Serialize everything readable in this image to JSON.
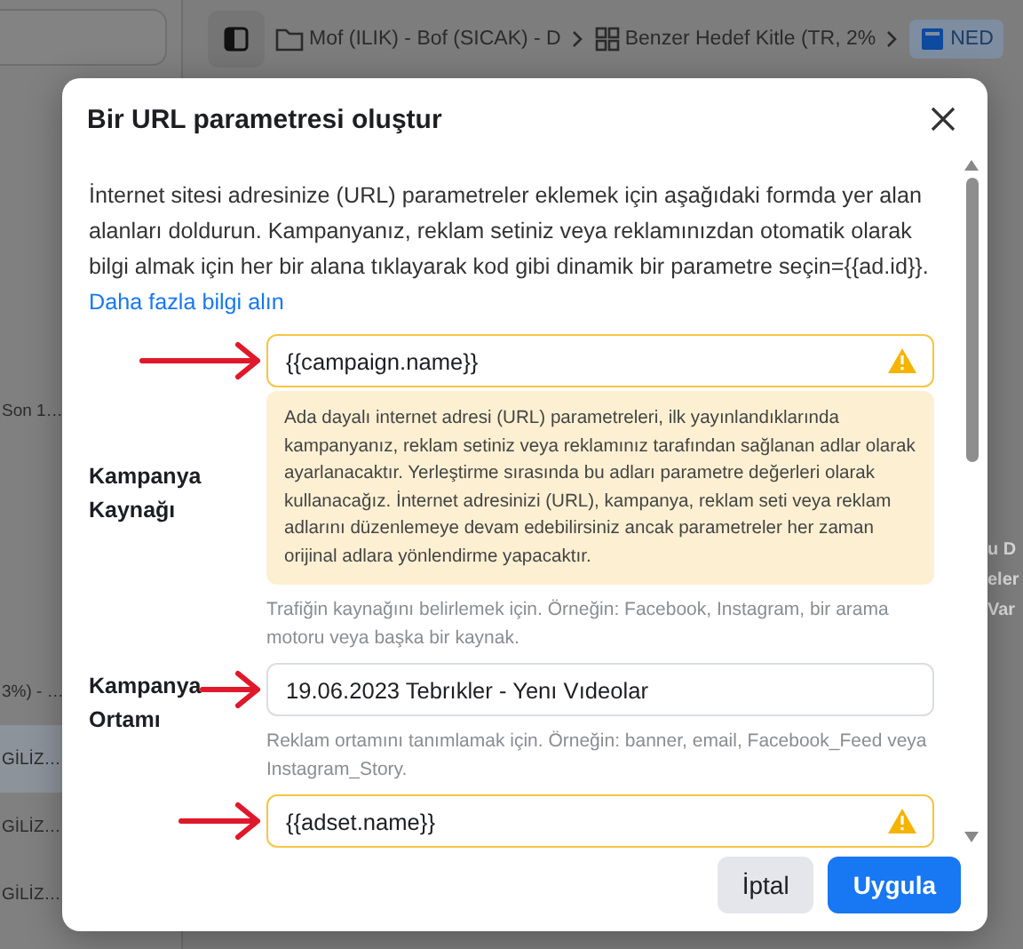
{
  "background": {
    "breadcrumbs": [
      {
        "kind": "folder",
        "label": "Mof (ILIK) - Bof (SICAK) - D"
      },
      {
        "kind": "grid",
        "label": "Benzer Hedef Kitle (TR, 2%"
      },
      {
        "kind": "ad",
        "label": "NED"
      }
    ],
    "sidebar_items": [
      {
        "label": "Son 1…",
        "selected": false
      },
      {
        "label": "3%) - …",
        "selected": false
      },
      {
        "label": "GİLİZ…",
        "selected": true
      },
      {
        "label": "GİLİZ…",
        "selected": false
      },
      {
        "label": "GİLİZ…",
        "selected": false
      }
    ],
    "preview_texts": [
      "u D",
      "eler",
      "Var"
    ]
  },
  "dialog": {
    "title": "Bir URL parametresi oluştur",
    "intro": "İnternet sitesi adresinize (URL) parametreler eklemek için aşağıdaki formda yer alan alanları doldurun. Kampanyanız, reklam setiniz veya reklamınızdan otomatik olarak bilgi almak için her bir alana tıklayarak kod gibi dinamik bir parametre seçin={{ad.id}}.",
    "intro_link": "Daha fazla bilgi alın",
    "fields": [
      {
        "label": "Kampanya Kaynağı",
        "value": "{{campaign.name}}",
        "warning": true,
        "arrow": true,
        "notice": "Ada dayalı internet adresi (URL) parametreleri, ilk yayınlandıklarında kampanyanız, reklam setiniz veya reklamınız tarafından sağlanan adlar olarak ayarlanacaktır. Yerleştirme sırasında bu adları parametre değerleri olarak kullanacağız. İnternet adresinizi (URL), kampanya, reklam seti veya reklam adlarını düzenlemeye devam edebilirsiniz ancak parametreler her zaman orijinal adlara yönlendirme yapacaktır.",
        "help": "Trafiğin kaynağını belirlemek için. Örneğin: Facebook, Instagram, bir arama motoru veya başka bir kaynak."
      },
      {
        "label": "Kampanya Ortamı",
        "value": "19.06.2023 Tebrıkler - Yenı Vıdeolar",
        "warning": false,
        "arrow": true,
        "help": "Reklam ortamını tanımlamak için. Örneğin: banner, email, Facebook_Feed veya Instagram_Story."
      },
      {
        "value": "{{adset.name}}",
        "warning": true,
        "arrow": true
      }
    ],
    "buttons": [
      {
        "label": "İptal",
        "kind": "secondary"
      },
      {
        "label": "Uygula",
        "kind": "primary"
      }
    ]
  }
}
